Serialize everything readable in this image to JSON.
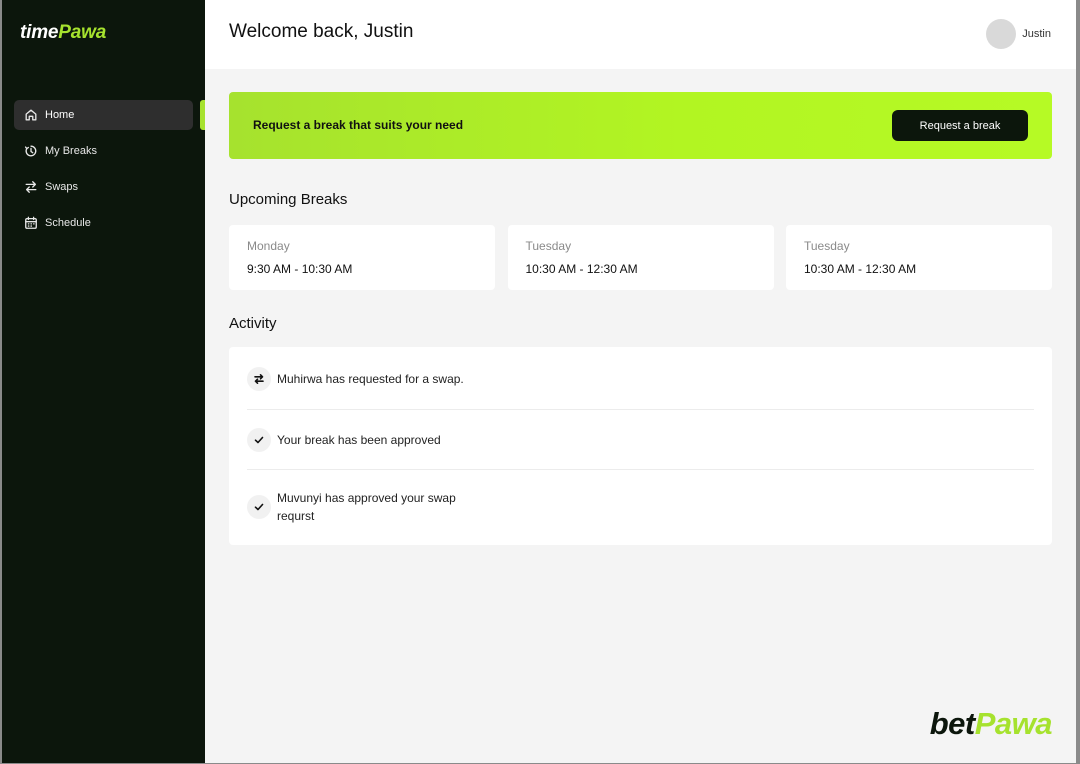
{
  "app": {
    "brand_prefix": "time",
    "brand_suffix": "Pawa"
  },
  "sidebar": {
    "items": [
      {
        "label": "Home",
        "icon": "home-icon",
        "active": true
      },
      {
        "label": "My Breaks",
        "icon": "timer-icon",
        "active": false
      },
      {
        "label": "Swaps",
        "icon": "swap-icon",
        "active": false
      },
      {
        "label": "Schedule",
        "icon": "calendar-icon",
        "active": false
      }
    ]
  },
  "header": {
    "welcome": "Welcome back, Justin",
    "user_name": "Justin"
  },
  "banner": {
    "text": "Request a break that suits your need",
    "button_label": "Request a break"
  },
  "upcoming": {
    "title": "Upcoming Breaks",
    "cards": [
      {
        "day": "Monday",
        "time": "9:30 AM - 10:30 AM"
      },
      {
        "day": "Tuesday",
        "time": "10:30 AM - 12:30 AM"
      },
      {
        "day": "Tuesday",
        "time": "10:30 AM - 12:30 AM"
      }
    ]
  },
  "activity": {
    "title": "Activity",
    "items": [
      {
        "icon": "swap-icon",
        "text": "Muhirwa has requested for a swap."
      },
      {
        "icon": "check-icon",
        "text": "Your break has been approved"
      },
      {
        "icon": "check-icon",
        "text": "Muvunyi has approved your swap requrst"
      }
    ]
  },
  "footer": {
    "logo_prefix": "bet",
    "logo_suffix": "Pawa"
  },
  "colors": {
    "accent": "#a6e22e",
    "sidebar_bg": "#0c160c",
    "page_bg": "#f4f4f4"
  }
}
